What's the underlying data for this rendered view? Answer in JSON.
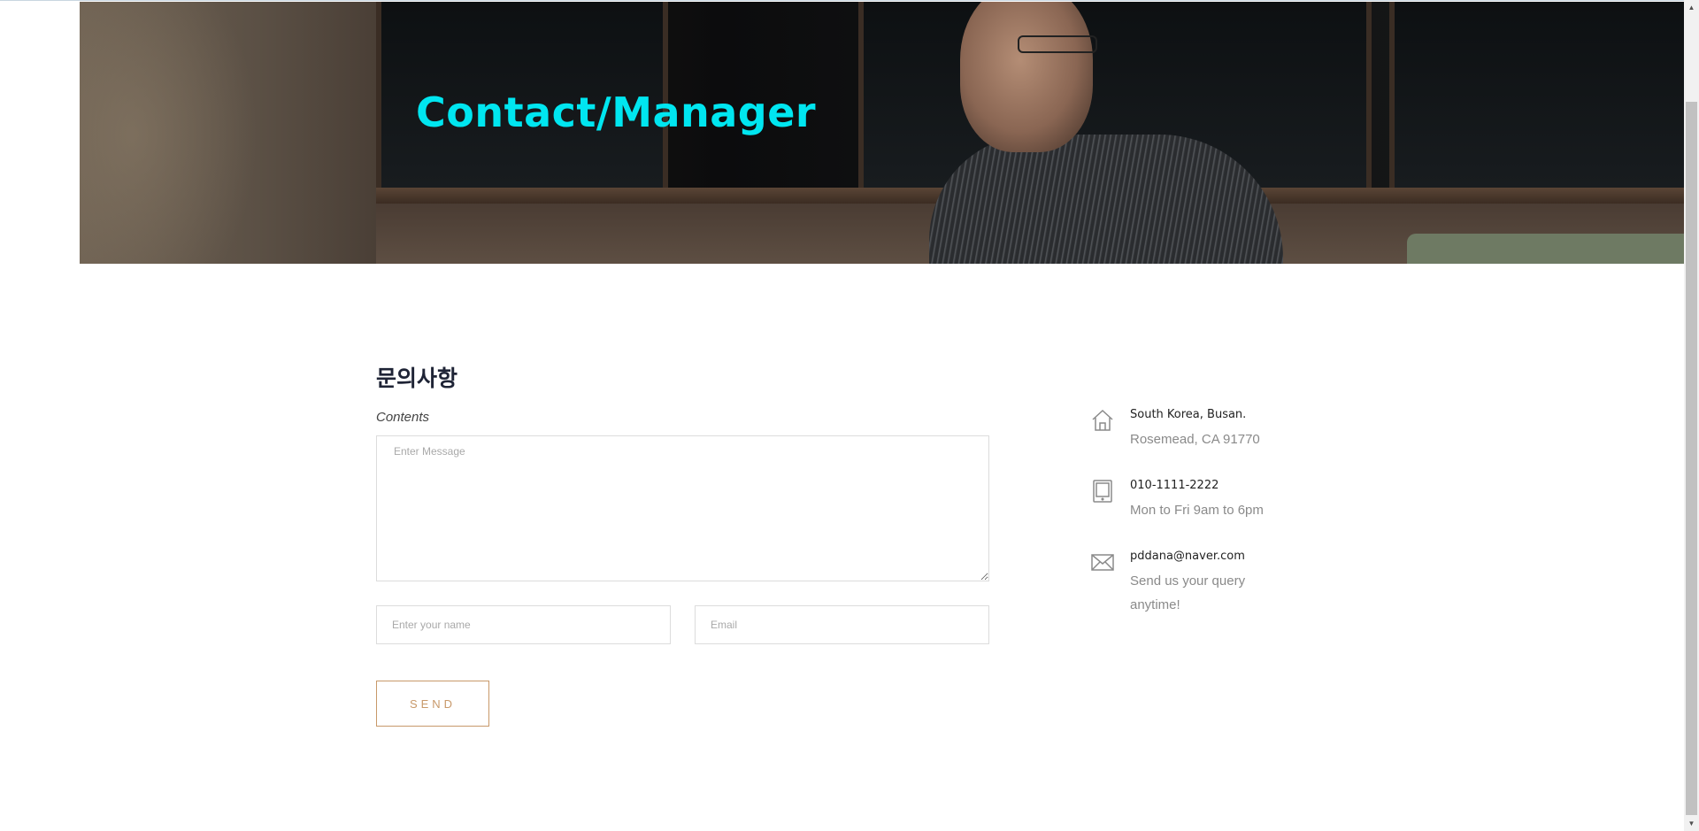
{
  "hero": {
    "title": "Contact/Manager"
  },
  "form": {
    "heading": "문의사항",
    "contents_label": "Contents",
    "message_placeholder": "Enter Message",
    "name_placeholder": "Enter your name",
    "email_placeholder": "Email",
    "send_label": "SEND"
  },
  "contact_info": [
    {
      "icon": "home-icon",
      "title": "South Korea, Busan.",
      "subtitle": "Rosemead, CA 91770"
    },
    {
      "icon": "tablet-icon",
      "title": "010-1111-2222",
      "subtitle": "Mon to Fri 9am to 6pm"
    },
    {
      "icon": "email-icon",
      "title": "pddana@naver.com",
      "subtitle": "Send us your query anytime!"
    }
  ],
  "colors": {
    "hero_title": "#00e6f0",
    "send_accent": "#c8996a",
    "heading": "#1f2436",
    "muted_text": "#8a8a8a"
  }
}
